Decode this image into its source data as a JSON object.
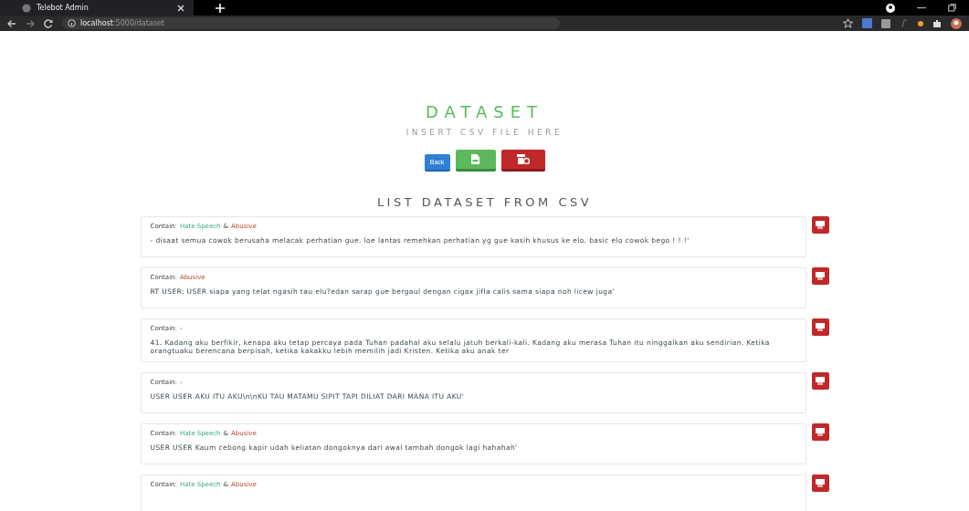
{
  "browser": {
    "tab_title": "Telebot Admin",
    "url_host": "localhost",
    "url_path": ":5000/dataset"
  },
  "header": {
    "title": "DATASET",
    "subtitle": "INSERT CSV FILE HERE",
    "back_button": "Back"
  },
  "list_title": "LIST DATASET FROM CSV",
  "entries": [
    {
      "prefix": "Contain:",
      "tags": [
        {
          "text": "Hate Speech",
          "kind": "hate"
        },
        {
          "text": "&",
          "kind": "joiner"
        },
        {
          "text": "Abusive",
          "kind": "abusive"
        }
      ],
      "text": "- disaat semua cowok berusaha melacak perhatian gue. loe lantas remehkan perhatian yg gue kasih khusus ke elo. basic elo cowok bego ! ! !'"
    },
    {
      "prefix": "Contain:",
      "tags": [
        {
          "text": "Abusive",
          "kind": "abusive"
        }
      ],
      "text": "RT USER: USER siapa yang telat ngasih tau elu?edan sarap gue bergaul dengan cigax jifla calis sama siapa noh licew juga'"
    },
    {
      "prefix": "Contain:",
      "tags": [
        {
          "text": "-",
          "kind": "none"
        }
      ],
      "text": "41. Kadang aku berfikir, kenapa aku tetap percaya pada Tuhan padahal aku selalu jatuh berkali-kali. Kadang aku merasa Tuhan itu ninggalkan aku sendirian. Ketika orangtuaku berencana berpisah, ketika kakakku lebih memilih jadi Kristen. Ketika aku anak ter"
    },
    {
      "prefix": "Contain:",
      "tags": [
        {
          "text": "-",
          "kind": "none"
        }
      ],
      "text": "USER USER AKU ITU AKU\\n\\nKU TAU MATAMU SIPIT TAPI DILIAT DARI MANA ITU AKU'"
    },
    {
      "prefix": "Contain:",
      "tags": [
        {
          "text": "Hate Speech",
          "kind": "hate"
        },
        {
          "text": "&",
          "kind": "joiner"
        },
        {
          "text": "Abusive",
          "kind": "abusive"
        }
      ],
      "text": "USER USER Kaum cebong kapir udah keliatan dongoknya dari awal tambah dongok lagi hahahah'"
    },
    {
      "prefix": "Contain:",
      "tags": [
        {
          "text": "Hate Speech",
          "kind": "hate"
        },
        {
          "text": "&",
          "kind": "joiner"
        },
        {
          "text": "Abusive",
          "kind": "abusive"
        }
      ]
    }
  ]
}
